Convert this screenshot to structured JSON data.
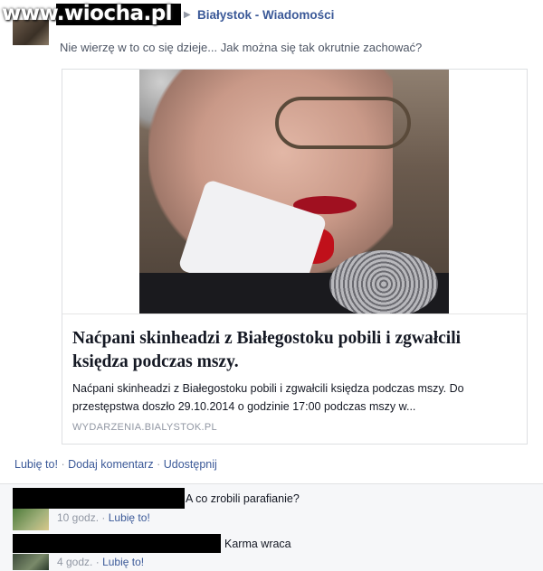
{
  "watermark": "www.wiocha.pl",
  "post": {
    "group_name": "Białystok - Wiadomości",
    "text": "Nie wierzę w to co się dzieje... Jak można się tak okrutnie zachować?"
  },
  "link_card": {
    "title": "Naćpani skinheadzi z Białegostoku pobili i zgwałcili księdza podczas mszy.",
    "description": "Naćpani skinheadzi z Białegostoku pobili i zgwałcili księdza podczas mszy. Do przestępstwa doszło 29.10.2014 o godzinie 17:00 podczas mszy w...",
    "source": "WYDARZENIA.BIALYSTOK.PL"
  },
  "actions": {
    "like": "Lubię to!",
    "comment": "Dodaj komentarz",
    "share": "Udostępnij",
    "separator": "·"
  },
  "comments": [
    {
      "text": "A co zrobili parafianie?",
      "time": "10 godz.",
      "like": "Lubię to!"
    },
    {
      "text": "Karma wraca",
      "time": "4 godz.",
      "like": "Lubię to!"
    }
  ],
  "colors": {
    "link": "#3b5998",
    "muted": "#9197a3",
    "comment_bg": "#f6f7f9"
  }
}
